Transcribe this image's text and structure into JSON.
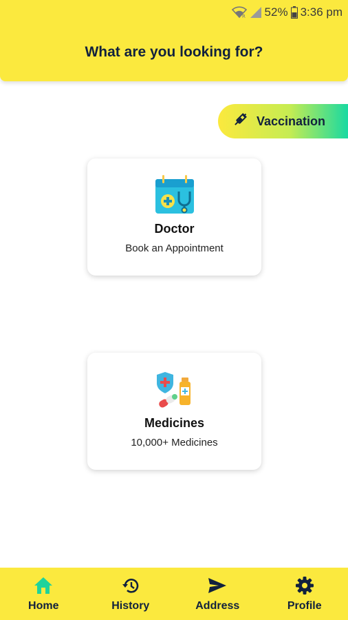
{
  "status_bar": {
    "battery": "52%",
    "time": "3:36 pm"
  },
  "header": {
    "title": "What are you looking for?"
  },
  "vaccination": {
    "label": "Vaccination",
    "icon": "syringe-icon"
  },
  "cards": [
    {
      "title": "Doctor",
      "subtitle": "Book an Appointment",
      "icon": "doctor-calendar-icon"
    },
    {
      "title": "Medicines",
      "subtitle": "10,000+ Medicines",
      "icon": "medicines-icon"
    }
  ],
  "nav": [
    {
      "label": "Home",
      "icon": "home-icon",
      "active": true
    },
    {
      "label": "History",
      "icon": "history-icon"
    },
    {
      "label": "Address",
      "icon": "send-icon"
    },
    {
      "label": "Profile",
      "icon": "gear-icon"
    }
  ],
  "colors": {
    "primary": "#fbe93e",
    "accent": "#19d9a1",
    "text": "#11213d",
    "active_nav": "#1fd39b"
  }
}
